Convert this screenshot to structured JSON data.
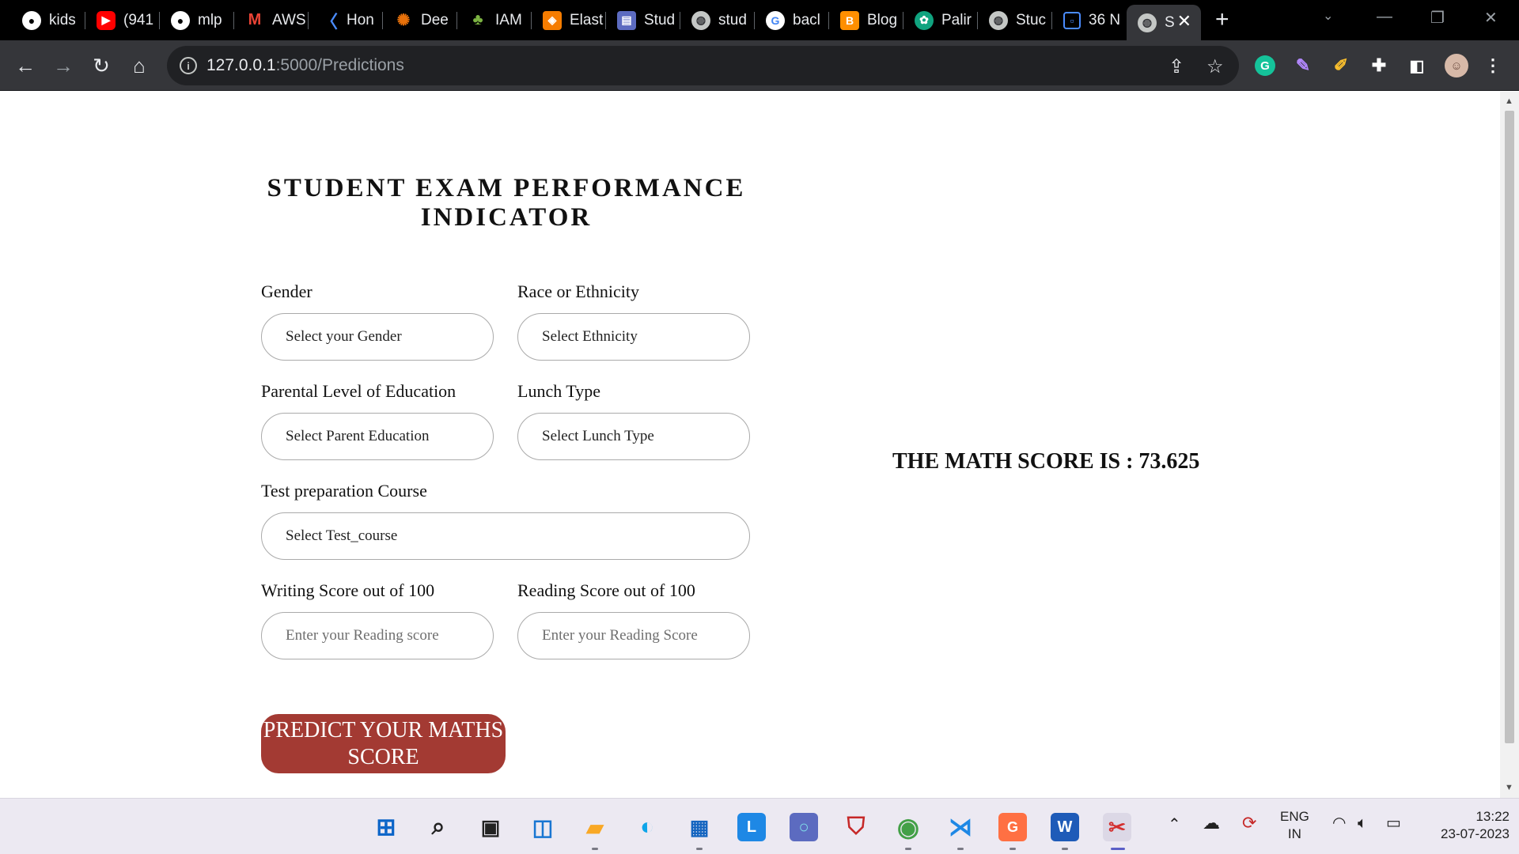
{
  "browser": {
    "tabs": [
      {
        "label": "kids",
        "icon": "github-icon",
        "color": "#ffffff"
      },
      {
        "label": "(941",
        "icon": "youtube-icon",
        "color": "#ff0000"
      },
      {
        "label": "mlp",
        "icon": "github-icon",
        "color": "#ffffff"
      },
      {
        "label": "AWS",
        "icon": "gmail-icon",
        "color": "#ea4335"
      },
      {
        "label": "Hon",
        "icon": "k-icon",
        "color": "#4a8cff"
      },
      {
        "label": "Dee",
        "icon": "deeplearning-icon",
        "color": "#e8710a"
      },
      {
        "label": "IAM",
        "icon": "leaf-icon",
        "color": "#7cb342"
      },
      {
        "label": "Elast",
        "icon": "elastic-icon",
        "color": "#f57c00"
      },
      {
        "label": "Stud",
        "icon": "store-icon",
        "color": "#5c6bc0"
      },
      {
        "label": "stud",
        "icon": "globe-icon",
        "color": "#c4c7c5"
      },
      {
        "label": "bacl",
        "icon": "google-icon",
        "color": "#ffffff"
      },
      {
        "label": "Blog",
        "icon": "blogger-icon",
        "color": "#ff8f00"
      },
      {
        "label": "Palir",
        "icon": "openai-icon",
        "color": "#10a37f"
      },
      {
        "label": "Stuc",
        "icon": "globe-icon",
        "color": "#c4c7c5"
      },
      {
        "label": "36 N",
        "icon": "outline-icon",
        "color": "#4a8cff"
      },
      {
        "label": "S",
        "icon": "globe-icon",
        "color": "#c4c7c5"
      }
    ],
    "url_host": "127.0.0.1",
    "url_path": ":5000/Predictions"
  },
  "form": {
    "title": "STUDENT EXAM PERFORMANCE INDICATOR",
    "gender_label": "Gender",
    "gender_value": "Select your Gender",
    "ethnicity_label": "Race or Ethnicity",
    "ethnicity_value": "Select Ethnicity",
    "parent_label": "Parental Level of Education",
    "parent_value": "Select Parent Education",
    "lunch_label": "Lunch Type",
    "lunch_value": "Select Lunch Type",
    "test_label": "Test preparation Course",
    "test_value": "Select Test_course",
    "writing_label": "Writing Score out of 100",
    "writing_placeholder": "Enter your Reading score",
    "reading_label": "Reading Score out of 100",
    "reading_placeholder": "Enter your Reading Score",
    "predict_label": "PREDICT YOUR MATHS SCORE"
  },
  "result": {
    "text": "THE MATH SCORE IS : 73.625"
  },
  "taskbar": {
    "lang": "ENG",
    "region": "IN",
    "time": "13:22",
    "date": "23-07-2023"
  }
}
